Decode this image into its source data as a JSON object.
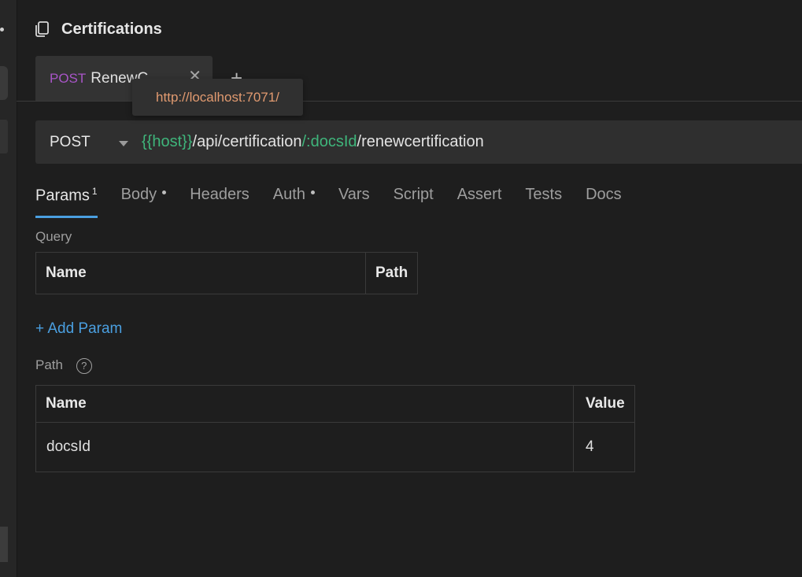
{
  "header": {
    "title": "Certifications",
    "icon": "copy-icon"
  },
  "tabs": [
    {
      "method": "POST",
      "name": "RenewC",
      "close": "✕"
    }
  ],
  "add_tab": "+",
  "tooltip": {
    "text": "http://localhost:7071/"
  },
  "url_bar": {
    "method": "POST",
    "segments": [
      {
        "text": "{{host}}",
        "kind": "var"
      },
      {
        "text": "/api/certification",
        "kind": "plain"
      },
      {
        "text": "/:docsId",
        "kind": "var"
      },
      {
        "text": "/renewcertification",
        "kind": "plain"
      }
    ]
  },
  "section_tabs": {
    "params": {
      "label": "Params",
      "badge": "1"
    },
    "body": {
      "label": "Body"
    },
    "headers": {
      "label": "Headers"
    },
    "auth": {
      "label": "Auth"
    },
    "vars": {
      "label": "Vars"
    },
    "script": {
      "label": "Script"
    },
    "assert": {
      "label": "Assert"
    },
    "tests": {
      "label": "Tests"
    },
    "docs": {
      "label": "Docs"
    }
  },
  "query": {
    "label": "Query",
    "columns": [
      "Name",
      "Path"
    ],
    "add_label": "+ Add Param"
  },
  "path": {
    "label": "Path",
    "help": "?",
    "columns": [
      "Name",
      "Value"
    ],
    "rows": [
      {
        "name": "docsId",
        "value": "4"
      }
    ]
  },
  "colors": {
    "accent": "#4a9fe0",
    "method_purple": "#a855c7",
    "var_green": "#3fb57b",
    "tooltip_orange": "#e19a70"
  }
}
